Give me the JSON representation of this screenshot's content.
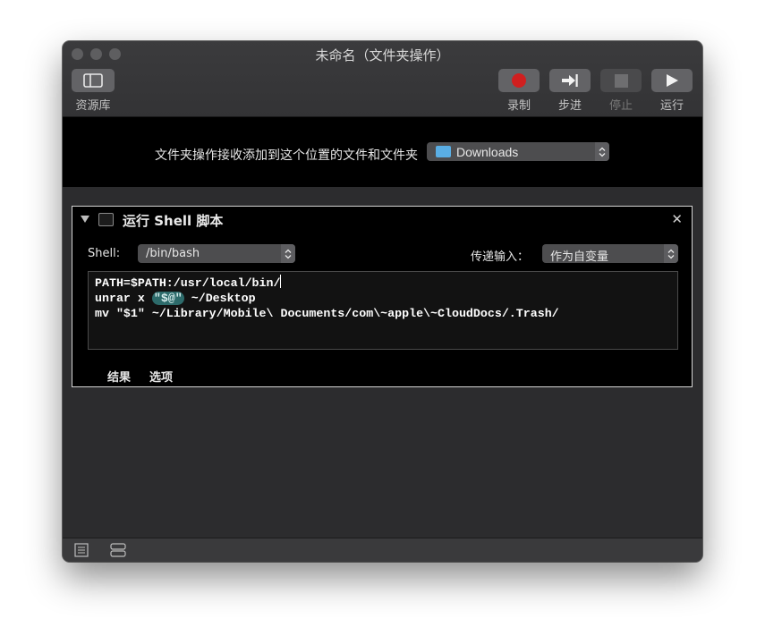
{
  "window": {
    "title": "未命名（文件夹操作）"
  },
  "toolbar": {
    "library_label": "资源库",
    "record_label": "录制",
    "step_label": "步进",
    "stop_label": "停止",
    "run_label": "运行"
  },
  "folder_action": {
    "label": "文件夹操作接收添加到这个位置的文件和文件夹",
    "folder": "Downloads"
  },
  "action": {
    "title": "运行 Shell 脚本",
    "shell_label": "Shell:",
    "shell_value": "/bin/bash",
    "pass_input_label": "传递输入：",
    "pass_input_value": "作为自变量",
    "code_line1": "PATH=$PATH:/usr/local/bin/",
    "code_line2_pre": "unrar x ",
    "code_line2_hl": "\"$@\"",
    "code_line2_post": " ~/Desktop",
    "code_line3": "mv \"$1\" ~/Library/Mobile\\ Documents/com\\~apple\\~CloudDocs/.Trash/",
    "tab_results": "结果",
    "tab_options": "选项"
  },
  "colors": {
    "record_red": "#d01f1f",
    "folder_blue": "#5aaee4",
    "highlight_teal": "#2d6b6b"
  },
  "icons": [
    "library-icon",
    "record-icon",
    "step-icon",
    "stop-icon",
    "run-icon",
    "folder-icon",
    "terminal-icon",
    "close-icon",
    "list-view-icon",
    "split-view-icon"
  ]
}
